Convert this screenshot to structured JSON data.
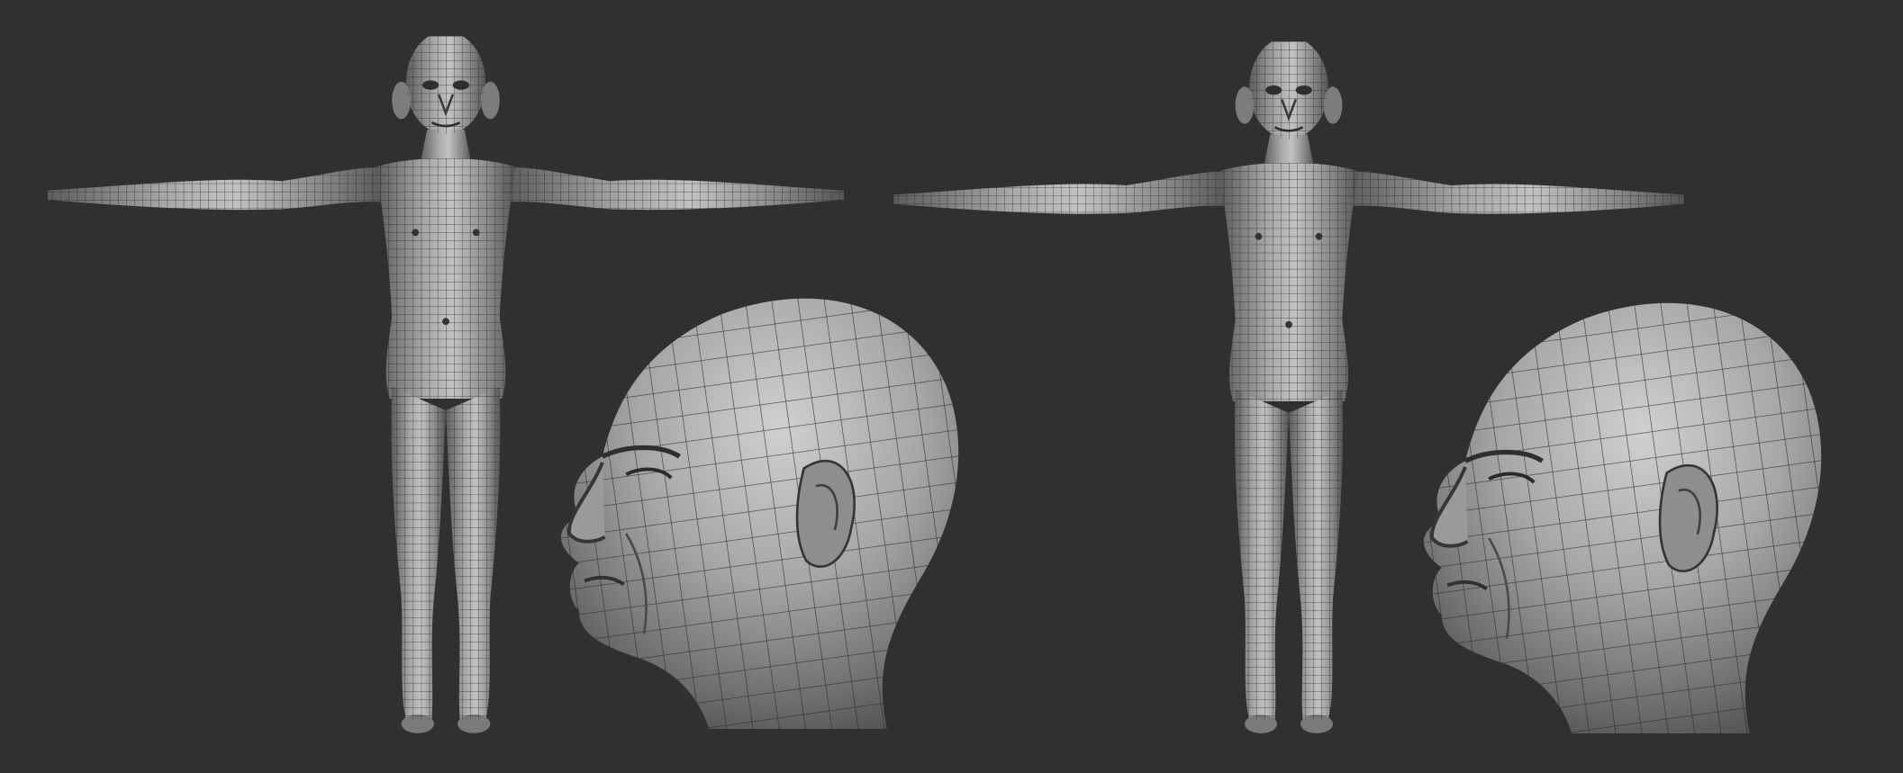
{
  "scene": {
    "background": "#303030",
    "mesh_fill": "#8f8f8f",
    "mesh_highlight": "#c6c6c6",
    "mesh_shadow": "#4b4b4b",
    "wire_color": "#222222",
    "renders": [
      {
        "kind": "full-body",
        "view": "front"
      },
      {
        "kind": "head",
        "view": "side-left"
      },
      {
        "kind": "full-body",
        "view": "front"
      },
      {
        "kind": "head",
        "view": "side-left"
      }
    ]
  }
}
